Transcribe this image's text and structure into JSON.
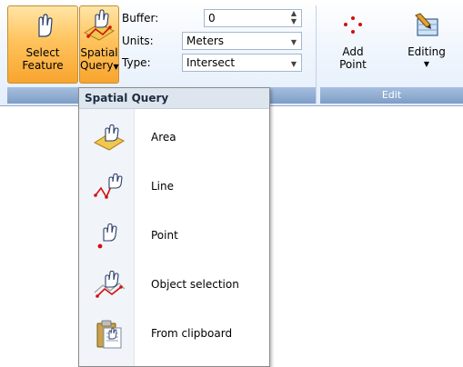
{
  "ribbon": {
    "select_feature": {
      "line1": "Select",
      "line2": "Feature"
    },
    "spatial_query": {
      "line1": "Spatial",
      "line2": "Query"
    },
    "buffer": {
      "label": "Buffer:",
      "value": "0"
    },
    "units": {
      "label": "Units:",
      "value": "Meters"
    },
    "type": {
      "label": "Type:",
      "value": "Intersect"
    },
    "add_point": {
      "line1": "Add",
      "line2": "Point"
    },
    "editing": {
      "label": "Editing"
    },
    "edit_group_label": "Edit"
  },
  "menu": {
    "title": "Spatial Query",
    "items": [
      {
        "label": "Area",
        "icon": "area-query-icon"
      },
      {
        "label": "Line",
        "icon": "line-query-icon"
      },
      {
        "label": "Point",
        "icon": "point-query-icon"
      },
      {
        "label": "Object selection",
        "icon": "object-selection-icon"
      },
      {
        "label": "From clipboard",
        "icon": "clipboard-icon"
      }
    ]
  }
}
